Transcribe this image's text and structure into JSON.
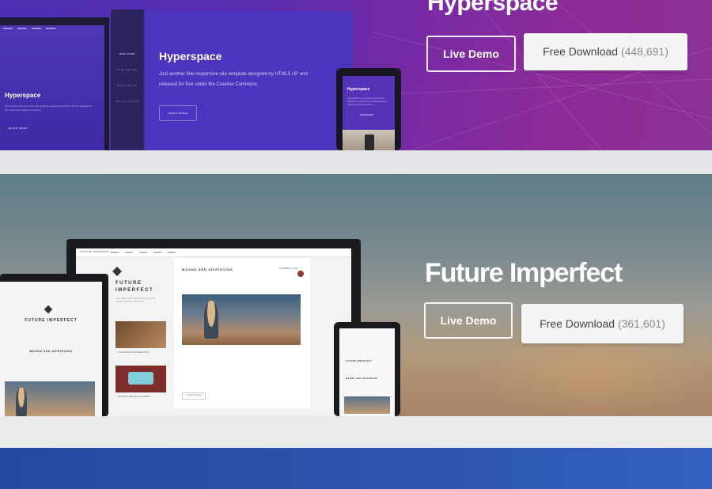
{
  "templates": [
    {
      "name": "Hyperspace",
      "preview": {
        "title": "Hyperspace",
        "description": "Just another fine responsive site template designed by HTML5 UP and released for free under the Creative Commons.",
        "button": "LEARN MORE",
        "nav": [
          "WELCOME",
          "WHO WE ARE",
          "WHAT WE DO",
          "GET IN TOUCH"
        ]
      },
      "live_demo_label": "Live Demo",
      "download_label": "Free Download",
      "download_count": "(448,691)"
    },
    {
      "name": "Future Imperfect",
      "preview": {
        "brand": "FUTURE IMPERFECT",
        "title": "FUTURE IMPERFECT",
        "subtitle": "ANOTHER FINE RESPONSIVE SITE TEMPLATE BY HTML5 UP",
        "post_title": "MAGNA SED ADIPISCING",
        "post_date": "NOVEMBER 1, 2015",
        "mini_post_1": "VITAE SED CONDIMENTUM",
        "mini_post_2": "RUTRUM NEQUE ACCUMSAN",
        "continue": "CONTINUE READING"
      },
      "live_demo_label": "Live Demo",
      "download_label": "Free Download",
      "download_count": "(361,601)"
    }
  ],
  "colors": {
    "hyperspace_bg": "#5a2db0",
    "future_imperfect_bg": "#7d8b90",
    "bottom_band": "#2c55b0"
  }
}
